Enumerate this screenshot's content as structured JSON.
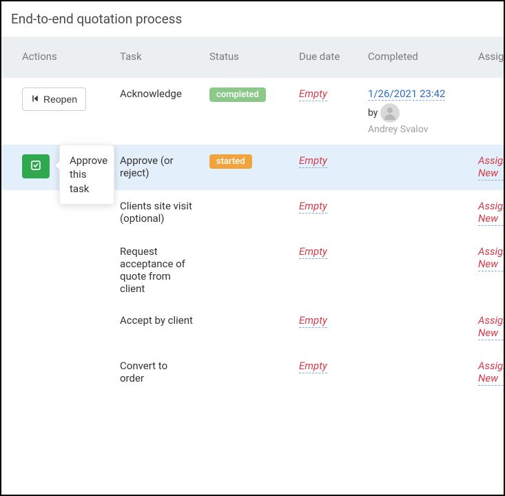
{
  "title": "End-to-end quotation process",
  "columns": {
    "actions": "Actions",
    "task": "Task",
    "status": "Status",
    "due": "Due date",
    "completed": "Completed",
    "assign": "Assign"
  },
  "labels": {
    "reopen": "Reopen",
    "empty": "Empty",
    "assign_new": "Assign New",
    "approve_tooltip": "Approve this task",
    "by": "by"
  },
  "status_badges": {
    "completed": "completed",
    "started": "started"
  },
  "rows": [
    {
      "task": "Acknowledge",
      "status": "completed",
      "due": "Empty",
      "completed_date": "1/26/2021 23:42",
      "completed_by": "Andrey Svalov",
      "action": "reopen"
    },
    {
      "task": "Approve (or reject)",
      "status": "started",
      "due": "Empty",
      "action": "approve",
      "highlight": true,
      "assign": "Assign New"
    },
    {
      "task": "Clients site visit (optional)",
      "due": "Empty",
      "assign": "Assign New"
    },
    {
      "task": "Request acceptance of quote from client",
      "due": "Empty",
      "assign": "Assign New"
    },
    {
      "task": "Accept by client",
      "due": "Empty",
      "assign": "Assign New"
    },
    {
      "task": "Convert to order",
      "due": "Empty",
      "assign": "Assign New"
    }
  ]
}
